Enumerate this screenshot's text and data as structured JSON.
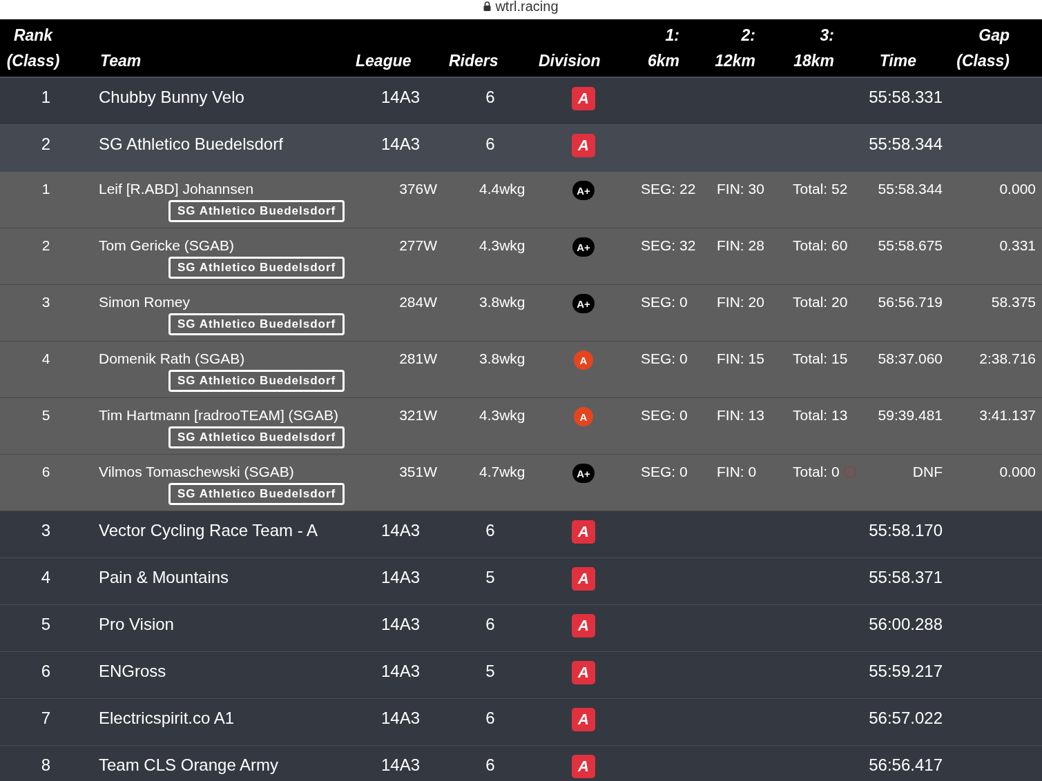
{
  "address_bar": {
    "url": "wtrl.racing"
  },
  "columns": [
    "Rank\n(Class)",
    "Team",
    "League",
    "Riders",
    "Division",
    "1:\n6km",
    "2:\n12km",
    "3:\n18km",
    "Time",
    "Gap\n(Class)"
  ],
  "teams": [
    {
      "rank": "1",
      "name": "Chubby Bunny Velo",
      "league": "14A3",
      "riders_count": "6",
      "division": {
        "label": "A",
        "color": "#e0313f"
      },
      "time": "55:58.331",
      "expanded": false
    },
    {
      "rank": "2",
      "name": "SG Athletico Buedelsdorf",
      "league": "14A3",
      "riders_count": "6",
      "division": {
        "label": "A",
        "color": "#e0313f"
      },
      "time": "55:58.344",
      "expanded": true,
      "riders": [
        {
          "rank": "1",
          "name": "Leif [R.ABD] Johannsen",
          "team_tag": "SG Athletico Buedelsdorf",
          "power": "376W",
          "wkg": "4.4wkg",
          "division": {
            "label": "A+",
            "color": "#000000"
          },
          "seg": "SEG: 22",
          "fin": "FIN: 30",
          "total": "Total: 52",
          "flagged": false,
          "time": "55:58.344",
          "gap": "0.000"
        },
        {
          "rank": "2",
          "name": "Tom Gericke (SGAB)",
          "team_tag": "SG Athletico Buedelsdorf",
          "power": "277W",
          "wkg": "4.3wkg",
          "division": {
            "label": "A+",
            "color": "#000000"
          },
          "seg": "SEG: 32",
          "fin": "FIN: 28",
          "total": "Total: 60",
          "flagged": false,
          "time": "55:58.675",
          "gap": "0.331"
        },
        {
          "rank": "3",
          "name": "Simon Romey",
          "team_tag": "SG Athletico Buedelsdorf",
          "power": "284W",
          "wkg": "3.8wkg",
          "division": {
            "label": "A+",
            "color": "#000000"
          },
          "seg": "SEG: 0",
          "fin": "FIN: 20",
          "total": "Total: 20",
          "flagged": false,
          "time": "56:56.719",
          "gap": "58.375"
        },
        {
          "rank": "4",
          "name": "Domenik Rath (SGAB)",
          "team_tag": "SG Athletico Buedelsdorf",
          "power": "281W",
          "wkg": "3.8wkg",
          "division": {
            "label": "A",
            "color": "#e4451f"
          },
          "seg": "SEG: 0",
          "fin": "FIN: 15",
          "total": "Total: 15",
          "flagged": false,
          "time": "58:37.060",
          "gap": "2:38.716"
        },
        {
          "rank": "5",
          "name": "Tim Hartmann [radrooTEAM] (SGAB)",
          "team_tag": "SG Athletico Buedelsdorf",
          "power": "321W",
          "wkg": "4.3wkg",
          "division": {
            "label": "A",
            "color": "#e4451f"
          },
          "seg": "SEG: 0",
          "fin": "FIN: 13",
          "total": "Total: 13",
          "flagged": false,
          "time": "59:39.481",
          "gap": "3:41.137"
        },
        {
          "rank": "6",
          "name": "Vilmos Tomaschewski (SGAB)",
          "team_tag": "SG Athletico Buedelsdorf",
          "power": "351W",
          "wkg": "4.7wkg",
          "division": {
            "label": "A+",
            "color": "#000000"
          },
          "seg": "SEG: 0",
          "fin": "FIN: 0",
          "total": "Total: 0",
          "flagged": true,
          "time": "DNF",
          "gap": "0.000"
        }
      ]
    },
    {
      "rank": "3",
      "name": "Vector Cycling Race Team - A",
      "league": "14A3",
      "riders_count": "6",
      "division": {
        "label": "A",
        "color": "#e0313f"
      },
      "time": "55:58.170",
      "expanded": false
    },
    {
      "rank": "4",
      "name": "Pain & Mountains",
      "league": "14A3",
      "riders_count": "5",
      "division": {
        "label": "A",
        "color": "#e0313f"
      },
      "time": "55:58.371",
      "expanded": false
    },
    {
      "rank": "5",
      "name": "Pro Vision",
      "league": "14A3",
      "riders_count": "6",
      "division": {
        "label": "A",
        "color": "#e0313f"
      },
      "time": "56:00.288",
      "expanded": false
    },
    {
      "rank": "6",
      "name": "ENGross",
      "league": "14A3",
      "riders_count": "5",
      "division": {
        "label": "A",
        "color": "#e0313f"
      },
      "time": "55:59.217",
      "expanded": false
    },
    {
      "rank": "7",
      "name": "Electricspirit.co A1",
      "league": "14A3",
      "riders_count": "6",
      "division": {
        "label": "A",
        "color": "#e0313f"
      },
      "time": "56:57.022",
      "expanded": false
    },
    {
      "rank": "8",
      "name": "Team CLS Orange Army",
      "league": "14A3",
      "riders_count": "6",
      "division": {
        "label": "A",
        "color": "#e0313f"
      },
      "time": "56:56.417",
      "expanded": false
    }
  ]
}
